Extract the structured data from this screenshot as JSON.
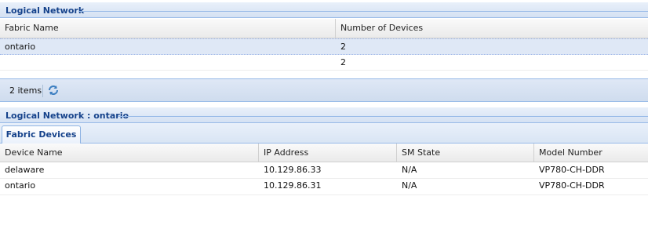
{
  "top_panel": {
    "title": "Logical Network",
    "columns": [
      "Fabric Name",
      "Number of Devices"
    ],
    "rows": [
      {
        "fabric_name": "ontario",
        "devices": "2"
      },
      {
        "fabric_name": "",
        "devices": "2"
      }
    ],
    "toolbar": {
      "count_label": "2 items",
      "refresh_icon": "refresh-icon"
    }
  },
  "bottom_panel": {
    "title": "Logical Network : ontario",
    "tab": "Fabric Devices",
    "columns": [
      "Device Name",
      "IP Address",
      "SM State",
      "Model Number"
    ],
    "rows": [
      {
        "name": "delaware",
        "ip": "10.129.86.33",
        "sm_state": "N/A",
        "model": "VP780-CH-DDR"
      },
      {
        "name": "ontario",
        "ip": "10.129.86.31",
        "sm_state": "N/A",
        "model": "VP780-CH-DDR"
      }
    ]
  },
  "colors": {
    "header_text": "#15428b",
    "border": "#99bbe8",
    "selected_row": "#dfe8f6"
  }
}
